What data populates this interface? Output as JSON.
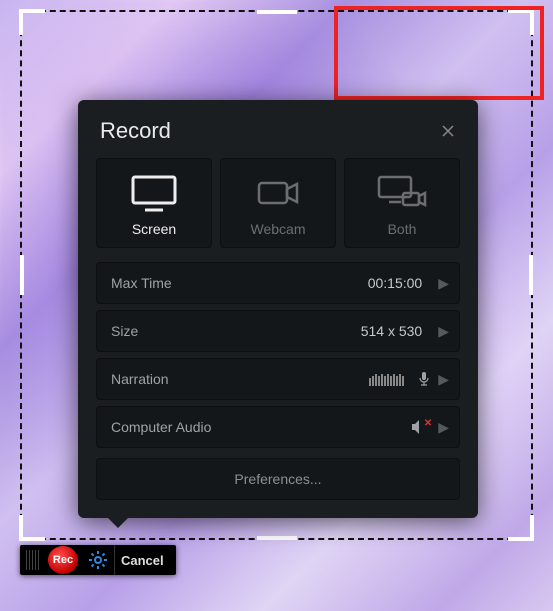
{
  "panel": {
    "title": "Record",
    "modes": [
      {
        "label": "Screen",
        "icon": "monitor-icon",
        "active": true
      },
      {
        "label": "Webcam",
        "icon": "camera-icon",
        "active": false
      },
      {
        "label": "Both",
        "icon": "monitor-camera-icon",
        "active": false
      }
    ],
    "settings": {
      "maxtime": {
        "label": "Max Time",
        "value": "00:15:00"
      },
      "size": {
        "label": "Size",
        "value": "514 x 530"
      },
      "narration": {
        "label": "Narration"
      },
      "audio": {
        "label": "Computer Audio",
        "muted": true
      }
    },
    "preferences_label": "Preferences..."
  },
  "toolbar": {
    "rec_label": "Rec",
    "cancel_label": "Cancel"
  }
}
